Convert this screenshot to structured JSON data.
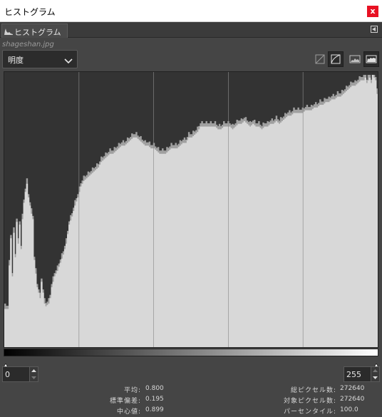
{
  "window": {
    "title": "ヒストグラム",
    "close_label": "x"
  },
  "tab": {
    "label": "ヒストグラム"
  },
  "image": {
    "filename": "shageshan.jpg"
  },
  "channel": {
    "selected": "明度"
  },
  "range": {
    "min_value": "0",
    "max_value": "255"
  },
  "stats": {
    "mean_label": "平均:",
    "mean": "0.800",
    "stddev_label": "標準偏差:",
    "stddev": "0.195",
    "median_label": "中心値:",
    "median": "0.899",
    "pixels_label": "総ピクセル数:",
    "pixels": "272640",
    "count_label": "対象ピクセル数:",
    "count": "272640",
    "percentile_label": "パーセンタイル:",
    "percentile": "100.0"
  },
  "colors": {
    "panel_bg": "#454545",
    "histogram_bg": "#333333",
    "histogram_fill": "#d8d8d8",
    "histogram_shadow": "#a0a0a0",
    "close_red": "#e81123"
  },
  "chart_data": {
    "type": "area",
    "x_range": [
      0,
      255
    ],
    "y_range": [
      0,
      1
    ],
    "grid_verticals": [
      51,
      102,
      153,
      204
    ],
    "profile": [
      [
        0,
        0.14
      ],
      [
        3,
        0.3
      ],
      [
        4,
        0.4
      ],
      [
        5,
        0.26
      ],
      [
        6,
        0.42
      ],
      [
        7,
        0.33
      ],
      [
        8,
        0.46
      ],
      [
        9,
        0.38
      ],
      [
        10,
        0.45
      ],
      [
        11,
        0.36
      ],
      [
        12,
        0.47
      ],
      [
        13,
        0.53
      ],
      [
        14,
        0.57
      ],
      [
        15,
        0.6
      ],
      [
        16,
        0.55
      ],
      [
        17,
        0.52
      ],
      [
        18,
        0.49
      ],
      [
        19,
        0.47
      ],
      [
        20,
        0.32
      ],
      [
        21,
        0.27
      ],
      [
        22,
        0.22
      ],
      [
        23,
        0.2
      ],
      [
        24,
        0.18
      ],
      [
        25,
        0.24
      ],
      [
        26,
        0.2
      ],
      [
        27,
        0.16
      ],
      [
        28,
        0.15
      ],
      [
        30,
        0.16
      ],
      [
        31,
        0.18
      ],
      [
        32,
        0.22
      ],
      [
        34,
        0.26
      ],
      [
        36,
        0.28
      ],
      [
        38,
        0.31
      ],
      [
        40,
        0.34
      ],
      [
        42,
        0.38
      ],
      [
        44,
        0.45
      ],
      [
        46,
        0.48
      ],
      [
        48,
        0.52
      ],
      [
        50,
        0.55
      ],
      [
        52,
        0.59
      ],
      [
        54,
        0.61
      ],
      [
        56,
        0.62
      ],
      [
        58,
        0.63
      ],
      [
        60,
        0.64
      ],
      [
        62,
        0.65
      ],
      [
        64,
        0.66
      ],
      [
        66,
        0.68
      ],
      [
        68,
        0.69
      ],
      [
        70,
        0.7
      ],
      [
        72,
        0.71
      ],
      [
        74,
        0.71
      ],
      [
        76,
        0.72
      ],
      [
        78,
        0.73
      ],
      [
        80,
        0.74
      ],
      [
        82,
        0.74
      ],
      [
        84,
        0.75
      ],
      [
        86,
        0.76
      ],
      [
        88,
        0.77
      ],
      [
        90,
        0.77
      ],
      [
        92,
        0.76
      ],
      [
        94,
        0.75
      ],
      [
        96,
        0.74
      ],
      [
        98,
        0.74
      ],
      [
        100,
        0.73
      ],
      [
        102,
        0.73
      ],
      [
        104,
        0.72
      ],
      [
        106,
        0.71
      ],
      [
        108,
        0.71
      ],
      [
        110,
        0.71
      ],
      [
        112,
        0.72
      ],
      [
        114,
        0.73
      ],
      [
        116,
        0.73
      ],
      [
        118,
        0.73
      ],
      [
        120,
        0.74
      ],
      [
        122,
        0.75
      ],
      [
        124,
        0.75
      ],
      [
        126,
        0.77
      ],
      [
        128,
        0.77
      ],
      [
        130,
        0.78
      ],
      [
        132,
        0.79
      ],
      [
        134,
        0.81
      ],
      [
        136,
        0.81
      ],
      [
        138,
        0.81
      ],
      [
        140,
        0.81
      ],
      [
        142,
        0.81
      ],
      [
        144,
        0.81
      ],
      [
        146,
        0.8
      ],
      [
        148,
        0.8
      ],
      [
        150,
        0.81
      ],
      [
        152,
        0.81
      ],
      [
        154,
        0.81
      ],
      [
        156,
        0.8
      ],
      [
        158,
        0.81
      ],
      [
        160,
        0.82
      ],
      [
        162,
        0.82
      ],
      [
        164,
        0.83
      ],
      [
        166,
        0.82
      ],
      [
        168,
        0.81
      ],
      [
        170,
        0.82
      ],
      [
        172,
        0.81
      ],
      [
        174,
        0.81
      ],
      [
        176,
        0.8
      ],
      [
        178,
        0.81
      ],
      [
        180,
        0.81
      ],
      [
        182,
        0.82
      ],
      [
        184,
        0.82
      ],
      [
        186,
        0.83
      ],
      [
        188,
        0.82
      ],
      [
        190,
        0.83
      ],
      [
        192,
        0.84
      ],
      [
        194,
        0.85
      ],
      [
        196,
        0.85
      ],
      [
        198,
        0.86
      ],
      [
        200,
        0.86
      ],
      [
        202,
        0.86
      ],
      [
        204,
        0.86
      ],
      [
        206,
        0.87
      ],
      [
        208,
        0.87
      ],
      [
        210,
        0.87
      ],
      [
        212,
        0.88
      ],
      [
        214,
        0.88
      ],
      [
        216,
        0.89
      ],
      [
        218,
        0.89
      ],
      [
        220,
        0.9
      ],
      [
        222,
        0.9
      ],
      [
        224,
        0.91
      ],
      [
        226,
        0.91
      ],
      [
        228,
        0.92
      ],
      [
        230,
        0.92
      ],
      [
        232,
        0.93
      ],
      [
        234,
        0.94
      ],
      [
        236,
        0.95
      ],
      [
        238,
        0.96
      ],
      [
        240,
        0.96
      ],
      [
        242,
        0.97
      ],
      [
        244,
        0.98
      ],
      [
        246,
        0.98
      ],
      [
        247,
        0.99
      ],
      [
        248,
        0.97
      ],
      [
        250,
        0.99
      ],
      [
        251,
        0.97
      ],
      [
        252,
        1.0
      ],
      [
        253,
        0.99
      ],
      [
        254,
        0.98
      ],
      [
        255,
        0.93
      ]
    ]
  }
}
